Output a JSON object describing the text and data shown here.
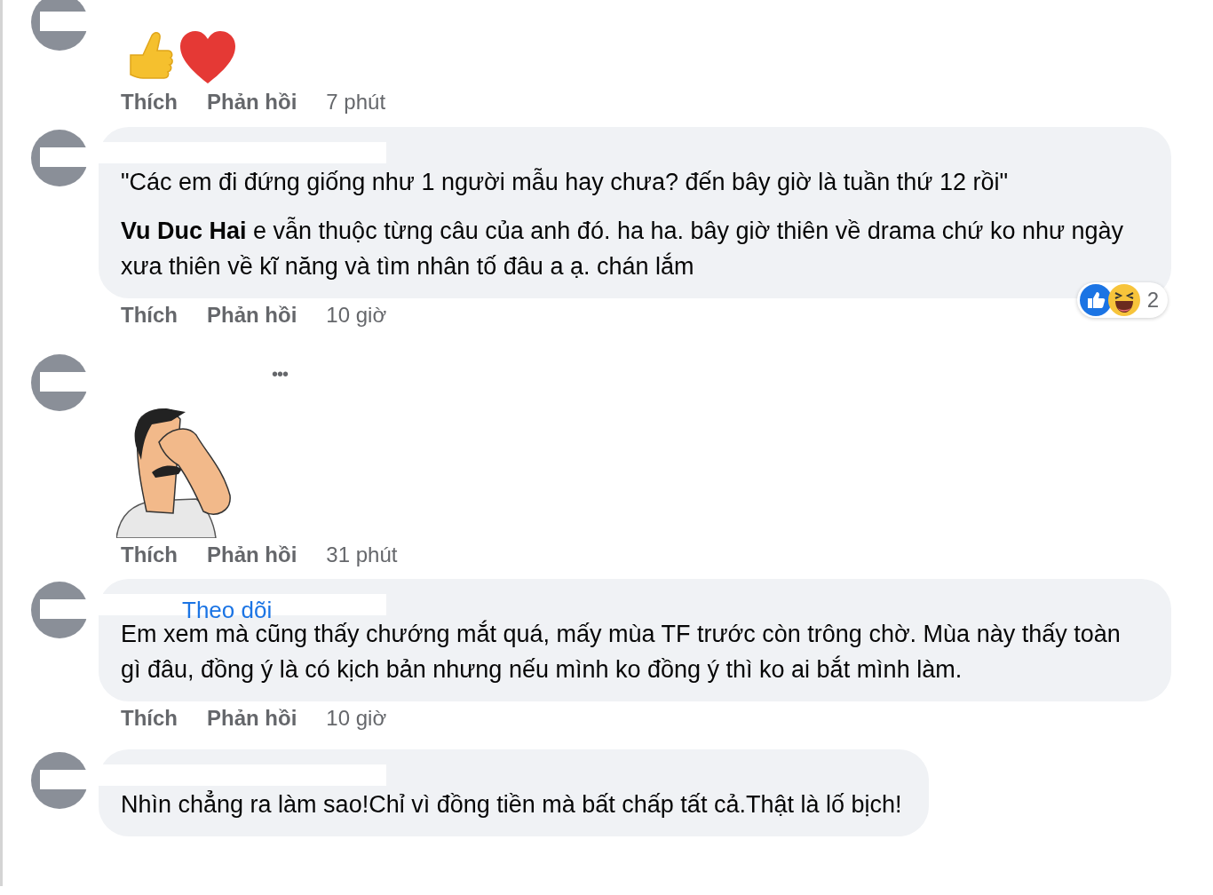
{
  "comments": [
    {
      "kind": "emoji_sticker",
      "actions": {
        "like": "Thích",
        "reply": "Phản hồi",
        "time": "7 phút"
      }
    },
    {
      "kind": "text",
      "paragraphs": [
        "\"Các em đi đứng giống như 1 người mẫu hay chưa? đến bây giờ là tuần thứ 12 rồi\"",
        "**Vu Duc Hai** e vẫn thuộc từng câu của anh đó. ha ha. bây giờ thiên về drama chứ ko như ngày xưa thiên về kĩ năng và tìm nhân tố đâu a ạ. chán lắm"
      ],
      "reactions": {
        "count": "2"
      },
      "actions": {
        "like": "Thích",
        "reply": "Phản hồi",
        "time": "10 giờ"
      }
    },
    {
      "kind": "cartoon_sticker",
      "more_button": "•••",
      "actions": {
        "like": "Thích",
        "reply": "Phản hồi",
        "time": "31 phút"
      }
    },
    {
      "kind": "text",
      "follow_link": "Theo dõi",
      "paragraphs": [
        "Em xem mà cũng thấy chướng mắt quá, mấy mùa TF trước còn trông chờ. Mùa này thấy toàn gì đâu, đồng ý là có kịch bản nhưng nếu mình ko đồng ý thì ko ai bắt mình làm."
      ],
      "actions": {
        "like": "Thích",
        "reply": "Phản hồi",
        "time": "10 giờ"
      }
    },
    {
      "kind": "text",
      "paragraphs": [
        "Nhìn chẳng ra làm sao!Chỉ vì đồng tiền mà bất chấp tất cả.Thật là lố bịch!"
      ]
    }
  ]
}
